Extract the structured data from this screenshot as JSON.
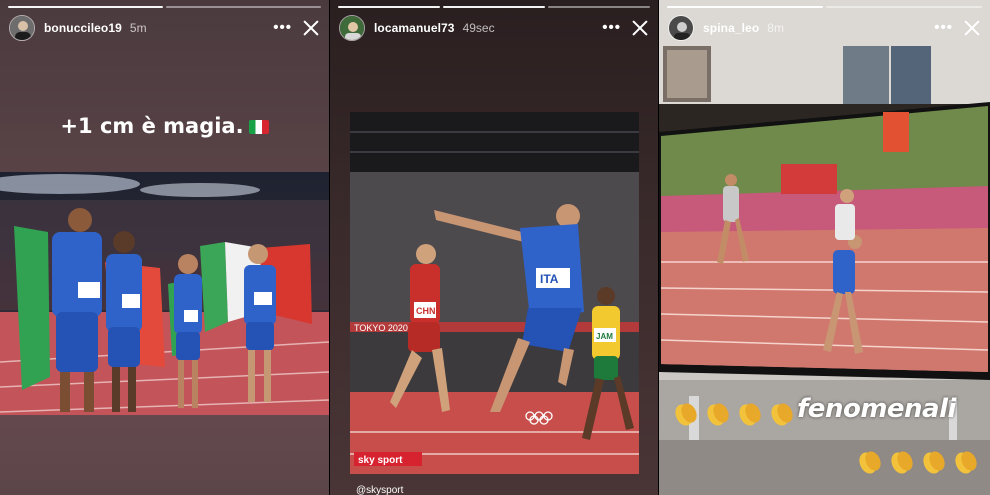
{
  "stories": [
    {
      "username": "bonuccileo19",
      "time": "5m",
      "caption": "+1 cm è magia.",
      "caption_emoji": "italy-flag"
    },
    {
      "username": "locamanuel73",
      "time": "49sec",
      "bib_chn": "CHN",
      "bib_ita": "ITA",
      "bib_jam": "JAM",
      "logo": "sky sport",
      "stadium_text": "TOKYO 2020",
      "handle": "@skysport"
    },
    {
      "username": "spina_leo",
      "time": "8m",
      "sticker_text": "fenomenali",
      "sticker_emoji": "clapping-hands"
    }
  ],
  "menu_icon": "more-dots",
  "close_icon": "close-x",
  "colors": {
    "italy_green": "#19a147",
    "italy_red": "#d6262f",
    "italy_blue": "#2e5fc6",
    "track_red": "#c0494a",
    "clap_yellow": "#f2c33a"
  }
}
